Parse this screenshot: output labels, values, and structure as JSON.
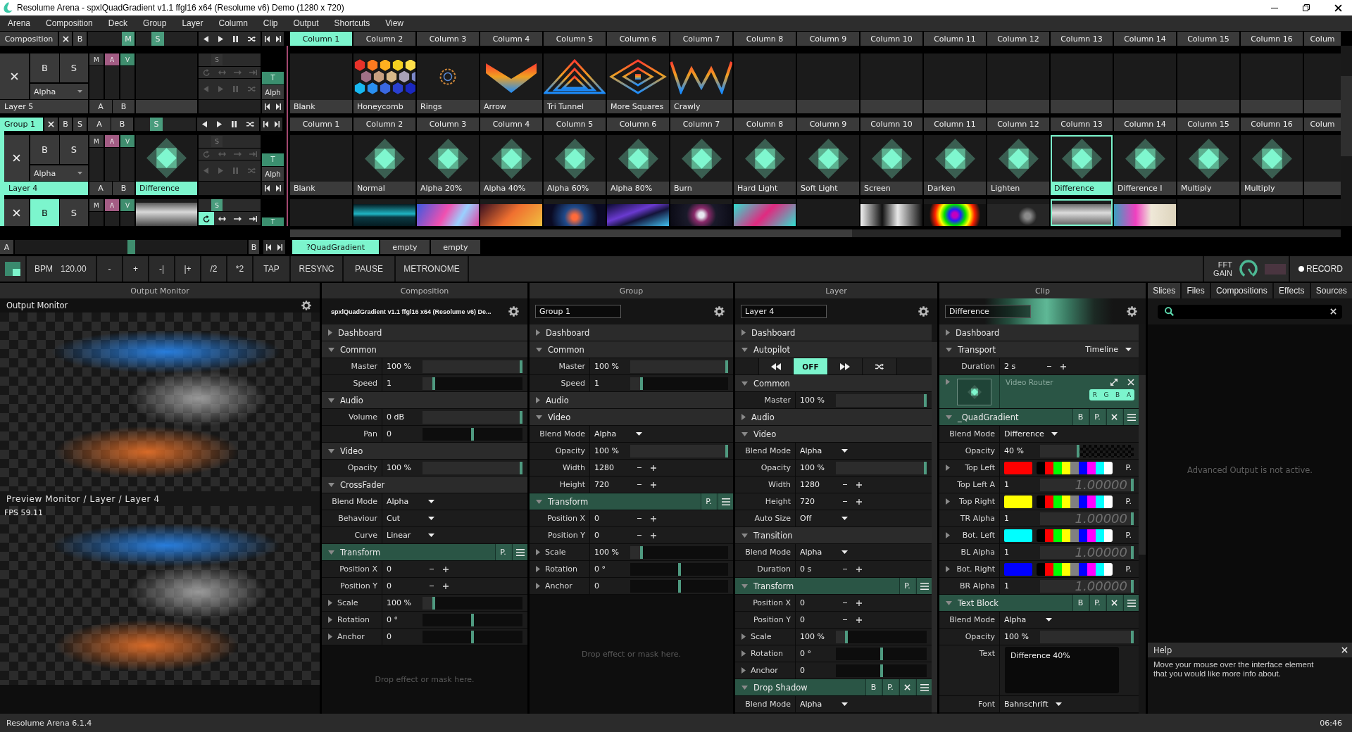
{
  "window": {
    "title": "Resolume Arena - spxlQuadGradient v1.1 ffgl16 x64 (Resolume v6) Demo (1280 x 720)"
  },
  "menu": [
    "Arena",
    "Composition",
    "Deck",
    "Group",
    "Layer",
    "Column",
    "Clip",
    "Output",
    "Shortcuts",
    "View"
  ],
  "deck": {
    "composition": {
      "label": "Composition",
      "toggles": [
        {
          "kind": "bypass",
          "label": "B",
          "on": false
        },
        {
          "kind": "mask",
          "label": "M",
          "on": true
        },
        {
          "kind": "solo",
          "label": "S",
          "on": true
        }
      ]
    },
    "columns": [
      {
        "label": "Column 1",
        "selected": true
      },
      {
        "label": "Column 2",
        "selected": false
      },
      {
        "label": "Column 3",
        "selected": false
      },
      {
        "label": "Column 4",
        "selected": false
      },
      {
        "label": "Column 5",
        "selected": false
      },
      {
        "label": "Column 6",
        "selected": false
      },
      {
        "label": "Column 7",
        "selected": false
      },
      {
        "label": "Column 8",
        "selected": false
      },
      {
        "label": "Column 9",
        "selected": false
      },
      {
        "label": "Column 10",
        "selected": false
      },
      {
        "label": "Column 11",
        "selected": false
      },
      {
        "label": "Column 12",
        "selected": false
      },
      {
        "label": "Column 13",
        "selected": false
      },
      {
        "label": "Column 14",
        "selected": false
      },
      {
        "label": "Column 15",
        "selected": false
      },
      {
        "label": "Column 16",
        "selected": false
      },
      {
        "label": "Colum",
        "selected": false
      }
    ],
    "layers": [
      {
        "kind": "full",
        "name": "Layer 5",
        "selected": false,
        "toggles": [
          {
            "kind": "bypass",
            "label": "B",
            "on": false
          },
          {
            "kind": "solo",
            "label": "S",
            "on": false
          }
        ],
        "blend": "Alpha",
        "channels": [
          {
            "kind": "mask",
            "label": "M",
            "on": false
          },
          {
            "kind": "audio",
            "label": "A",
            "on": true
          },
          {
            "kind": "video",
            "label": "V",
            "on": true
          }
        ],
        "transport": {
          "disabled": true,
          "solo": {
            "label": "S",
            "on": false
          },
          "modes": [
            {
              "kind": "loop",
              "selected": false
            },
            {
              "kind": "bounce",
              "selected": false
            },
            {
              "kind": "once",
              "selected": false
            },
            {
              "kind": "hold",
              "selected": false
            }
          ]
        },
        "transition": {
          "label": "T",
          "blend": "Alph"
        },
        "crossfade": [
          "A",
          "B"
        ],
        "clips": [
          {
            "kind": "blank",
            "label": "Blank",
            "selected": false
          },
          {
            "kind": "hexagons",
            "label": "Honeycomb",
            "selected": false
          },
          {
            "kind": "rings",
            "label": "Rings",
            "selected": false
          },
          {
            "kind": "chevron",
            "label": "Arrow",
            "selected": false
          },
          {
            "kind": "triangles",
            "label": "Tri Tunnel",
            "selected": false
          },
          {
            "kind": "diamonds",
            "label": "More Squares",
            "selected": false
          },
          {
            "kind": "zigzag",
            "label": "Crawly",
            "selected": false
          },
          {
            "kind": "empty",
            "selected": false
          },
          {
            "kind": "empty",
            "selected": false
          },
          {
            "kind": "empty",
            "selected": false
          },
          {
            "kind": "empty",
            "selected": false
          },
          {
            "kind": "empty",
            "selected": false
          },
          {
            "kind": "empty",
            "selected": false
          },
          {
            "kind": "empty",
            "selected": false
          },
          {
            "kind": "empty",
            "selected": false
          },
          {
            "kind": "empty",
            "selected": false
          },
          {
            "kind": "empty",
            "selected": false
          }
        ]
      }
    ],
    "group": {
      "name": "Group 1",
      "selected": true,
      "toggles": [
        {
          "kind": "bypass",
          "label": "B",
          "on": false
        },
        {
          "kind": "solo",
          "label": "S",
          "on": false
        }
      ],
      "crossfade": [
        "A",
        "B"
      ],
      "solo": {
        "label": "S",
        "on": true
      },
      "columns": [
        {
          "label": "Column 1",
          "selected": false
        },
        {
          "label": "Column 2",
          "selected": false
        },
        {
          "label": "Column 3",
          "selected": false
        },
        {
          "label": "Column 4",
          "selected": false
        },
        {
          "label": "Column 5",
          "selected": false
        },
        {
          "label": "Column 6",
          "selected": false
        },
        {
          "label": "Column 7",
          "selected": false
        },
        {
          "label": "Column 8",
          "selected": false
        },
        {
          "label": "Column 9",
          "selected": false
        },
        {
          "label": "Column 10",
          "selected": false
        },
        {
          "label": "Column 11",
          "selected": false
        },
        {
          "label": "Column 12",
          "selected": false
        },
        {
          "label": "Column 13",
          "selected": false
        },
        {
          "label": "Column 14",
          "selected": false
        },
        {
          "label": "Column 15",
          "selected": false
        },
        {
          "label": "Column 16",
          "selected": false
        },
        {
          "label": "Colum",
          "selected": false
        }
      ],
      "layers": [
        {
          "kind": "full",
          "name": "Layer 4",
          "selected": true,
          "toggles": [
            {
              "kind": "bypass",
              "label": "B",
              "on": false
            },
            {
              "kind": "solo",
              "label": "S",
              "on": false
            }
          ],
          "blend": "Alpha",
          "channels": [
            {
              "kind": "mask",
              "label": "M",
              "on": false
            },
            {
              "kind": "audio",
              "label": "A",
              "on": true
            },
            {
              "kind": "video",
              "label": "V",
              "on": true
            }
          ],
          "thumb": {
            "kind": "quad"
          },
          "transport": {
            "disabled": true,
            "solo": {
              "label": "S",
              "on": false
            },
            "modes": [
              {
                "kind": "loop",
                "selected": false
              },
              {
                "kind": "bounce",
                "selected": false
              },
              {
                "kind": "once",
                "selected": false
              },
              {
                "kind": "hold",
                "selected": false
              }
            ]
          },
          "transition": {
            "label": "T",
            "blend": "Alph"
          },
          "crossfade": [
            "A",
            "B"
          ],
          "clip_label": "Difference",
          "clips": [
            {
              "kind": "blank",
              "label": "Blank",
              "selected": false
            },
            {
              "kind": "quad",
              "label": "Normal",
              "selected": false
            },
            {
              "kind": "quad",
              "label": "Alpha 20%",
              "selected": false
            },
            {
              "kind": "quad",
              "label": "Alpha 40%",
              "selected": false
            },
            {
              "kind": "quad",
              "label": "Alpha 60%",
              "selected": false
            },
            {
              "kind": "quad",
              "label": "Alpha 80%",
              "selected": false
            },
            {
              "kind": "quad",
              "label": "Burn",
              "selected": false
            },
            {
              "kind": "quad",
              "label": "Hard Light",
              "selected": false
            },
            {
              "kind": "quad",
              "label": "Soft Light",
              "selected": false
            },
            {
              "kind": "quad",
              "label": "Screen",
              "selected": false
            },
            {
              "kind": "quad",
              "label": "Darken",
              "selected": false
            },
            {
              "kind": "quad",
              "label": "Lighten",
              "selected": false
            },
            {
              "kind": "quad",
              "label": "Difference",
              "selected": true
            },
            {
              "kind": "quad",
              "label": "Difference I",
              "selected": false
            },
            {
              "kind": "quad",
              "label": "Multiply",
              "selected": false
            },
            {
              "kind": "quad",
              "label": "Multiply",
              "selected": false
            },
            {
              "kind": "empty",
              "selected": false
            }
          ]
        },
        {
          "kind": "clipped",
          "toggles": [
            {
              "kind": "bypass",
              "label": "B",
              "on": true
            },
            {
              "kind": "solo",
              "label": "S",
              "on": false
            }
          ],
          "channels": [
            {
              "kind": "mask",
              "label": "M",
              "on": false
            },
            {
              "kind": "audio",
              "label": "A",
              "on": true
            },
            {
              "kind": "video",
              "label": "V",
              "on": true
            }
          ],
          "thumb": {
            "kind": "video"
          },
          "transport": {
            "disabled": false,
            "solo": {
              "label": "S",
              "on": true
            },
            "modes": [
              {
                "kind": "loop",
                "selected": true
              },
              {
                "kind": "bounce",
                "selected": false
              },
              {
                "kind": "once",
                "selected": false
              },
              {
                "kind": "hold",
                "selected": false
              }
            ]
          },
          "transition": {
            "label": "T"
          },
          "clips": [
            {
              "kind": "empty",
              "selected": false
            },
            {
              "kind": "video",
              "selected": false
            },
            {
              "kind": "video",
              "selected": false
            },
            {
              "kind": "video",
              "selected": false
            },
            {
              "kind": "video",
              "selected": false
            },
            {
              "kind": "video",
              "selected": false
            },
            {
              "kind": "video",
              "selected": false
            },
            {
              "kind": "video",
              "selected": false
            },
            {
              "kind": "empty",
              "selected": false
            },
            {
              "kind": "video",
              "selected": false
            },
            {
              "kind": "video",
              "selected": false
            },
            {
              "kind": "video",
              "selected": false
            },
            {
              "kind": "video",
              "selected": true
            },
            {
              "kind": "video",
              "selected": false
            },
            {
              "kind": "empty",
              "selected": false
            },
            {
              "kind": "empty",
              "selected": false
            },
            {
              "kind": "empty",
              "selected": false
            }
          ]
        }
      ]
    }
  },
  "crossfader": {
    "labels": [
      "A",
      "B"
    ],
    "level": 0.5
  },
  "decks": [
    {
      "label": "?QuadGradient",
      "selected": true
    },
    {
      "label": "empty",
      "selected": false
    },
    {
      "label": "empty",
      "selected": false
    }
  ],
  "toolbar": {
    "bpm_label": "BPM",
    "bpm": "120.00",
    "buttons": [
      "-",
      "+",
      "-|",
      "|+",
      "/2",
      "*2",
      "TAP",
      "RESYNC",
      "PAUSE",
      "METRONOME"
    ],
    "fft_label": "FFT GAIN",
    "record": "RECORD"
  },
  "output_monitor": {
    "title": "Output Monitor",
    "label": "Output Monitor",
    "preview_label": "Preview Monitor / Layer / Layer 4",
    "fps": "FPS 59.11"
  },
  "inspector": {
    "composition": {
      "title": "Composition",
      "header": {
        "kind": "text",
        "value": "spxlQuadGradient v1.1 ffgl16 x64 (Resolume v6) De..."
      },
      "rows": [
        {
          "kind": "section",
          "label": "Dashboard",
          "expanded": false
        },
        {
          "kind": "section",
          "label": "Common",
          "expanded": true
        },
        {
          "kind": "slider",
          "label": "Master",
          "value": "100 %",
          "level": 1
        },
        {
          "kind": "slider",
          "label": "Speed",
          "value": "1",
          "level": 0.1
        },
        {
          "kind": "section",
          "label": "Audio",
          "expanded": true
        },
        {
          "kind": "slider",
          "label": "Volume",
          "value": "0 dB",
          "level": 1
        },
        {
          "kind": "balance",
          "label": "Pan",
          "value": "0",
          "level": 0.5
        },
        {
          "kind": "section",
          "label": "Video",
          "expanded": true
        },
        {
          "kind": "slider",
          "label": "Opacity",
          "value": "100 %",
          "level": 1
        },
        {
          "kind": "section",
          "label": "CrossFader",
          "expanded": true
        },
        {
          "kind": "dropdown",
          "label": "Blend Mode",
          "value": "Alpha"
        },
        {
          "kind": "dropdown",
          "label": "Behaviour",
          "value": "Cut"
        },
        {
          "kind": "dropdown",
          "label": "Curve",
          "value": "Linear"
        },
        {
          "kind": "effect",
          "label": "Transform",
          "expanded": true,
          "buttons": [
            "P."
          ],
          "removable": false
        },
        {
          "kind": "stepper",
          "label": "Position X",
          "value": "0"
        },
        {
          "kind": "stepper",
          "label": "Position Y",
          "value": "0"
        },
        {
          "kind": "slider",
          "label": "Scale",
          "value": "100 %",
          "level": 0.1,
          "expanded": false
        },
        {
          "kind": "balance",
          "label": "Rotation",
          "value": "0 °",
          "level": 0.5,
          "expanded": false
        },
        {
          "kind": "balance",
          "label": "Anchor",
          "value": "0",
          "level": 0.5,
          "expanded": false
        }
      ],
      "drop_hint": "Drop effect or mask here."
    },
    "group": {
      "title": "Group",
      "header": {
        "kind": "field",
        "value": "Group 1"
      },
      "rows": [
        {
          "kind": "section",
          "label": "Dashboard",
          "expanded": false
        },
        {
          "kind": "section",
          "label": "Common",
          "expanded": true
        },
        {
          "kind": "slider",
          "label": "Master",
          "value": "100 %",
          "level": 1
        },
        {
          "kind": "slider",
          "label": "Speed",
          "value": "1",
          "level": 0.1
        },
        {
          "kind": "section",
          "label": "Audio",
          "expanded": false
        },
        {
          "kind": "section",
          "label": "Video",
          "expanded": true
        },
        {
          "kind": "dropdown",
          "label": "Blend Mode",
          "value": "Alpha"
        },
        {
          "kind": "slider",
          "label": "Opacity",
          "value": "100 %",
          "level": 1
        },
        {
          "kind": "stepper",
          "label": "Width",
          "value": "1280"
        },
        {
          "kind": "stepper",
          "label": "Height",
          "value": "720"
        },
        {
          "kind": "effect",
          "label": "Transform",
          "expanded": true,
          "buttons": [
            "P."
          ],
          "removable": false
        },
        {
          "kind": "stepper",
          "label": "Position X",
          "value": "0"
        },
        {
          "kind": "stepper",
          "label": "Position Y",
          "value": "0"
        },
        {
          "kind": "slider",
          "label": "Scale",
          "value": "100 %",
          "level": 0.1,
          "expanded": false
        },
        {
          "kind": "balance",
          "label": "Rotation",
          "value": "0 °",
          "level": 0.5,
          "expanded": false
        },
        {
          "kind": "balance",
          "label": "Anchor",
          "value": "0",
          "level": 0.5,
          "expanded": false
        }
      ],
      "drop_hint": "Drop effect or mask here."
    },
    "layer": {
      "title": "Layer",
      "header": {
        "kind": "field",
        "value": "Layer 4"
      },
      "rows": [
        {
          "kind": "section",
          "label": "Dashboard",
          "expanded": false
        },
        {
          "kind": "section",
          "label": "Autopilot",
          "expanded": true
        },
        {
          "kind": "autopilot",
          "modes": [
            {
              "kind": "rewind",
              "selected": false
            },
            {
              "kind": "off",
              "label": "OFF",
              "selected": true
            },
            {
              "kind": "forward",
              "selected": false
            },
            {
              "kind": "random",
              "selected": false
            }
          ]
        },
        {
          "kind": "section",
          "label": "Common",
          "expanded": true
        },
        {
          "kind": "slider",
          "label": "Master",
          "value": "100 %",
          "level": 1
        },
        {
          "kind": "section",
          "label": "Audio",
          "expanded": false
        },
        {
          "kind": "section",
          "label": "Video",
          "expanded": true
        },
        {
          "kind": "dropdown",
          "label": "Blend Mode",
          "value": "Alpha"
        },
        {
          "kind": "slider",
          "label": "Opacity",
          "value": "100 %",
          "level": 1
        },
        {
          "kind": "stepper",
          "label": "Width",
          "value": "1280"
        },
        {
          "kind": "stepper",
          "label": "Height",
          "value": "720"
        },
        {
          "kind": "dropdown",
          "label": "Auto Size",
          "value": "Off"
        },
        {
          "kind": "section",
          "label": "Transition",
          "expanded": true
        },
        {
          "kind": "dropdown",
          "label": "Blend Mode",
          "value": "Alpha"
        },
        {
          "kind": "stepper",
          "label": "Duration",
          "value": "0 s"
        },
        {
          "kind": "effect",
          "label": "Transform",
          "expanded": true,
          "buttons": [
            "P."
          ],
          "removable": false
        },
        {
          "kind": "stepper",
          "label": "Position X",
          "value": "0"
        },
        {
          "kind": "stepper",
          "label": "Position Y",
          "value": "0"
        },
        {
          "kind": "slider",
          "label": "Scale",
          "value": "100 %",
          "level": 0.1,
          "expanded": false
        },
        {
          "kind": "balance",
          "label": "Rotation",
          "value": "0 °",
          "level": 0.5,
          "expanded": false
        },
        {
          "kind": "balance",
          "label": "Anchor",
          "value": "0",
          "level": 0.5,
          "expanded": false
        },
        {
          "kind": "effect",
          "label": "Drop Shadow",
          "expanded": true,
          "buttons": [
            "B",
            "P."
          ],
          "removable": true
        },
        {
          "kind": "dropdown",
          "label": "Blend Mode",
          "value": "Alpha"
        }
      ]
    },
    "clip": {
      "title": "Clip",
      "header": {
        "kind": "banner",
        "value": "Difference"
      },
      "rows": [
        {
          "kind": "section",
          "label": "Dashboard",
          "expanded": false
        },
        {
          "kind": "section",
          "label": "Transport",
          "expanded": true,
          "value": "Timeline"
        },
        {
          "kind": "stepper",
          "label": "Duration",
          "value": "2 s"
        },
        {
          "kind": "router",
          "label": "Video Router",
          "expanded": false,
          "channels": [
            {
              "label": "R",
              "on": true
            },
            {
              "label": "G",
              "on": true
            },
            {
              "label": "B",
              "on": true
            },
            {
              "label": "A",
              "on": true
            }
          ]
        },
        {
          "kind": "effect",
          "label": "_QuadGradient",
          "expanded": true,
          "buttons": [
            "B",
            "P."
          ],
          "removable": true
        },
        {
          "kind": "dropdown",
          "label": "Blend Mode",
          "value": "Difference"
        },
        {
          "kind": "fade",
          "label": "Opacity",
          "value": "40 %",
          "level": 0.4
        },
        {
          "kind": "color",
          "label": "Top Left",
          "expanded": false,
          "color": "#ff0000",
          "button": "P."
        },
        {
          "kind": "slider",
          "label": "Top Left A",
          "value": "1",
          "level": 1,
          "track_text": "1.00000"
        },
        {
          "kind": "color",
          "label": "Top Right",
          "expanded": false,
          "color": "#ffff00",
          "button": "P."
        },
        {
          "kind": "slider",
          "label": "TR Alpha",
          "value": "1",
          "level": 1,
          "track_text": "1.00000"
        },
        {
          "kind": "color",
          "label": "Bot. Left",
          "expanded": false,
          "color": "#00ffff",
          "button": "P."
        },
        {
          "kind": "slider",
          "label": "BL Alpha",
          "value": "1",
          "level": 1,
          "track_text": "1.00000"
        },
        {
          "kind": "color",
          "label": "Bot. Right",
          "expanded": false,
          "color": "#0000ff",
          "button": "P."
        },
        {
          "kind": "slider",
          "label": "BR Alpha",
          "value": "1",
          "level": 1,
          "track_text": "1.00000"
        },
        {
          "kind": "effect",
          "label": "Text Block",
          "expanded": true,
          "buttons": [
            "B",
            "P."
          ],
          "removable": true
        },
        {
          "kind": "dropdown",
          "label": "Blend Mode",
          "value": "Alpha"
        },
        {
          "kind": "slider",
          "label": "Opacity",
          "value": "100 %",
          "level": 1
        },
        {
          "kind": "textarea",
          "label": "Text",
          "value": "Difference 40%"
        },
        {
          "kind": "dropdown",
          "label": "Font",
          "value": "Bahnschrift"
        }
      ]
    }
  },
  "browser": {
    "tabs": [
      {
        "label": "Slices",
        "selected": true
      },
      {
        "label": "Files",
        "selected": false
      },
      {
        "label": "Compositions",
        "selected": false
      },
      {
        "label": "Effects",
        "selected": false
      },
      {
        "label": "Sources",
        "selected": false
      }
    ],
    "message": "Advanced Output is not active.",
    "help": {
      "title": "Help",
      "text": "Move your mouse over the interface element that you would like more info about."
    }
  },
  "status_bar": {
    "app": "Resolume Arena 6.1.4",
    "time": "06:46"
  }
}
